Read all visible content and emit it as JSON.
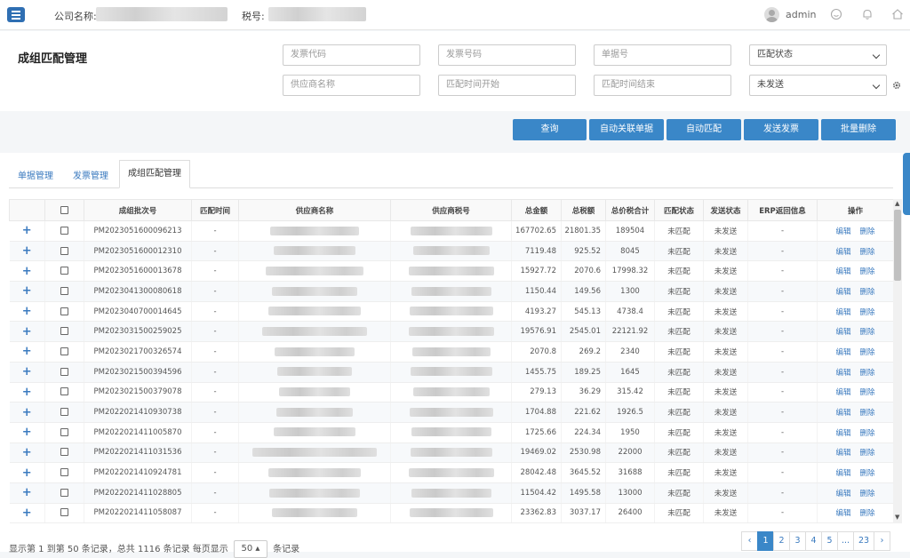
{
  "header": {
    "company_label": "公司名称:",
    "tax_label": "税号:",
    "username": "admin"
  },
  "page": {
    "title": "成组匹配管理"
  },
  "filters": {
    "invoice_code_placeholder": "发票代码",
    "invoice_number_placeholder": "发票号码",
    "document_number_placeholder": "单据号",
    "match_status_value": "匹配状态",
    "supplier_name_placeholder": "供应商名称",
    "match_time_start_placeholder": "匹配时间开始",
    "match_time_end_placeholder": "匹配时间结束",
    "send_status_value": "未发送"
  },
  "actions": {
    "query": "查询",
    "auto_link": "自动关联单据",
    "auto_match": "自动匹配",
    "send_invoice": "发送发票",
    "batch_delete": "批量删除"
  },
  "tabs": {
    "documents": "单据管理",
    "invoices": "发票管理",
    "group_match": "成组匹配管理"
  },
  "table": {
    "headers": [
      "成组批次号",
      "匹配时间",
      "供应商名称",
      "供应商税号",
      "总金额",
      "总税额",
      "总价税合计",
      "匹配状态",
      "发送状态",
      "ERP返回信息",
      "操作"
    ],
    "edit_label": "编辑",
    "delete_label": "删除",
    "rows": [
      {
        "batch": "PM2023051600096213",
        "time": "-",
        "amount": "167702.65",
        "tax": "21801.35",
        "total": "189504",
        "match": "未匹配",
        "send": "未发送",
        "erp": "-"
      },
      {
        "batch": "PM2023051600012310",
        "time": "-",
        "amount": "7119.48",
        "tax": "925.52",
        "total": "8045",
        "match": "未匹配",
        "send": "未发送",
        "erp": "-"
      },
      {
        "batch": "PM2023051600013678",
        "time": "-",
        "amount": "15927.72",
        "tax": "2070.6",
        "total": "17998.32",
        "match": "未匹配",
        "send": "未发送",
        "erp": "-"
      },
      {
        "batch": "PM2023041300080618",
        "time": "-",
        "amount": "1150.44",
        "tax": "149.56",
        "total": "1300",
        "match": "未匹配",
        "send": "未发送",
        "erp": "-"
      },
      {
        "batch": "PM2023040700014645",
        "time": "-",
        "amount": "4193.27",
        "tax": "545.13",
        "total": "4738.4",
        "match": "未匹配",
        "send": "未发送",
        "erp": "-"
      },
      {
        "batch": "PM2023031500259025",
        "time": "-",
        "amount": "19576.91",
        "tax": "2545.01",
        "total": "22121.92",
        "match": "未匹配",
        "send": "未发送",
        "erp": "-"
      },
      {
        "batch": "PM2023021700326574",
        "time": "-",
        "amount": "2070.8",
        "tax": "269.2",
        "total": "2340",
        "match": "未匹配",
        "send": "未发送",
        "erp": "-"
      },
      {
        "batch": "PM2023021500394596",
        "time": "-",
        "amount": "1455.75",
        "tax": "189.25",
        "total": "1645",
        "match": "未匹配",
        "send": "未发送",
        "erp": "-"
      },
      {
        "batch": "PM2023021500379078",
        "time": "-",
        "amount": "279.13",
        "tax": "36.29",
        "total": "315.42",
        "match": "未匹配",
        "send": "未发送",
        "erp": "-"
      },
      {
        "batch": "PM2022021410930738",
        "time": "-",
        "amount": "1704.88",
        "tax": "221.62",
        "total": "1926.5",
        "match": "未匹配",
        "send": "未发送",
        "erp": "-"
      },
      {
        "batch": "PM2022021411005870",
        "time": "-",
        "amount": "1725.66",
        "tax": "224.34",
        "total": "1950",
        "match": "未匹配",
        "send": "未发送",
        "erp": "-"
      },
      {
        "batch": "PM2022021411031536",
        "time": "-",
        "amount": "19469.02",
        "tax": "2530.98",
        "total": "22000",
        "match": "未匹配",
        "send": "未发送",
        "erp": "-"
      },
      {
        "batch": "PM2022021410924781",
        "time": "-",
        "amount": "28042.48",
        "tax": "3645.52",
        "total": "31688",
        "match": "未匹配",
        "send": "未发送",
        "erp": "-"
      },
      {
        "batch": "PM2022021411028805",
        "time": "-",
        "amount": "11504.42",
        "tax": "1495.58",
        "total": "13000",
        "match": "未匹配",
        "send": "未发送",
        "erp": "-"
      },
      {
        "batch": "PM2022021411058087",
        "time": "-",
        "amount": "23362.83",
        "tax": "3037.17",
        "total": "26400",
        "match": "未匹配",
        "send": "未发送",
        "erp": "-"
      }
    ]
  },
  "footer": {
    "info_prefix": "显示第 1 到第 50 条记录，总共 1116 条记录 每页显示",
    "page_size": "50",
    "info_suffix": "条记录"
  },
  "pagination": {
    "prev": "‹",
    "pages": [
      "1",
      "2",
      "3",
      "4",
      "5",
      "...",
      "23"
    ],
    "next": "›",
    "current": "1"
  }
}
